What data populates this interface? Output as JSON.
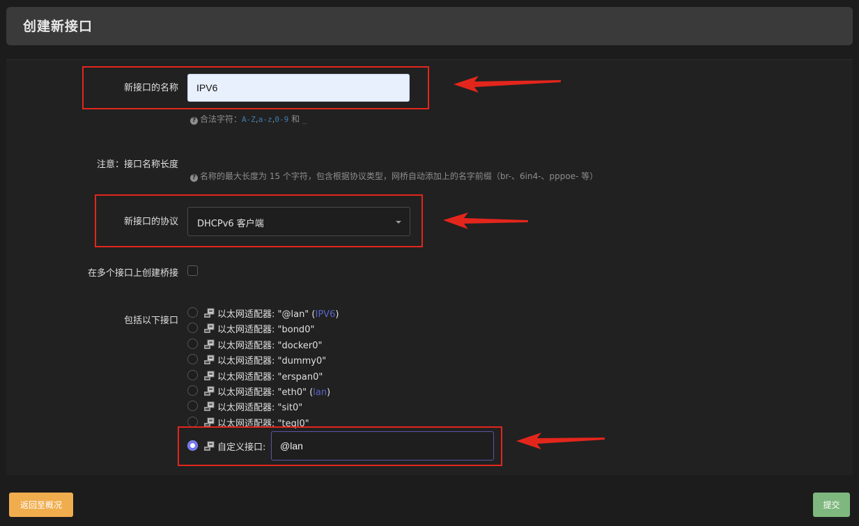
{
  "header": {
    "title": "创建新接口"
  },
  "form": {
    "name": {
      "label": "新接口的名称",
      "value": "IPV6",
      "hint_prefix": "合法字符：",
      "hint_code1": "A-Z",
      "hint_sep1": ",",
      "hint_code2": "a-z",
      "hint_sep2": ",",
      "hint_code3": "0-9",
      "hint_and": " 和 ",
      "hint_code4": "_"
    },
    "note": {
      "label": "注意：接口名称长度",
      "hint": "名称的最大长度为 15 个字符，包含根据协议类型，网桥自动添加上的名字前缀（br-、6in4-、pppoe- 等）"
    },
    "protocol": {
      "label": "新接口的协议",
      "selected": "DHCPv6 客户端"
    },
    "bridge": {
      "label": "在多个接口上创建桥接",
      "checked": false
    },
    "interfaces": {
      "label": "包括以下接口",
      "items": [
        {
          "text": "以太网适配器: \"@lan\" (",
          "net": "IPV6",
          "close": ")"
        },
        {
          "text": "以太网适配器: \"bond0\"",
          "net": "",
          "close": ""
        },
        {
          "text": "以太网适配器: \"docker0\"",
          "net": "",
          "close": ""
        },
        {
          "text": "以太网适配器: \"dummy0\"",
          "net": "",
          "close": ""
        },
        {
          "text": "以太网适配器: \"erspan0\"",
          "net": "",
          "close": ""
        },
        {
          "text": "以太网适配器: \"eth0\" (",
          "net": "lan",
          "close": ")"
        },
        {
          "text": "以太网适配器: \"sit0\"",
          "net": "",
          "close": ""
        },
        {
          "text": "以太网适配器: \"teql0\"",
          "net": "",
          "close": ""
        }
      ],
      "custom_label": "自定义接口:",
      "custom_value": "@lan"
    }
  },
  "footer": {
    "back_label": "返回至概况",
    "submit_label": "提交"
  },
  "colors": {
    "annotation_red": "#e3261c",
    "back_button": "#f0ad4e",
    "submit_button": "#7fb87f",
    "radio_accent": "#6f74f0"
  }
}
